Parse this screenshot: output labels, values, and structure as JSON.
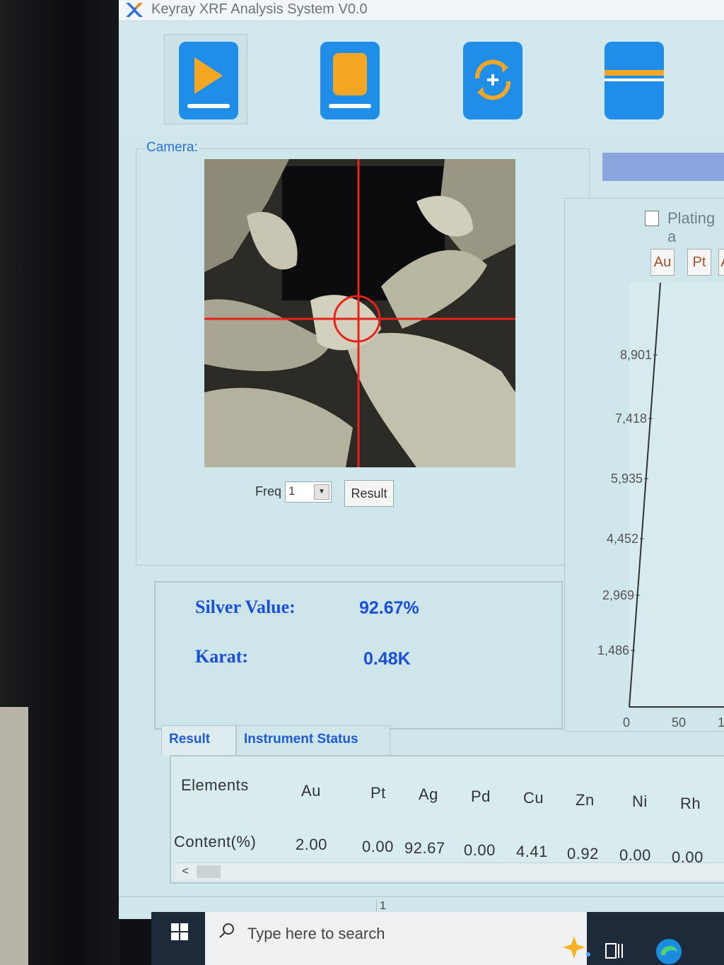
{
  "window": {
    "title": "Keyray XRF Analysis System V0.0"
  },
  "toolbar": {
    "buttons": [
      {
        "icon": "play-icon",
        "color": "#f5a623"
      },
      {
        "icon": "stop-icon",
        "color": "#f5a623"
      },
      {
        "icon": "refresh-icon",
        "color": "#f5a623"
      },
      {
        "icon": "folder-icon",
        "color": "#f5a623"
      }
    ]
  },
  "camera": {
    "label": "Camera:",
    "freq_label": "Freq",
    "freq_value": "1",
    "result_button": "Result"
  },
  "measurement": {
    "silver_label": "Silver Value:",
    "silver_value": "92.67%",
    "karat_label": "Karat:",
    "karat_value": "0.48K"
  },
  "spectrum": {
    "plating_label": "Plating a",
    "element_buttons": [
      "Au",
      "Pt",
      "A"
    ]
  },
  "chart_data": {
    "type": "line",
    "title": "",
    "xlabel": "",
    "ylabel": "",
    "y_ticks": [
      "8,901",
      "7,418",
      "5,935",
      "4,452",
      "2,969",
      "1,486"
    ],
    "x_ticks": [
      "0",
      "50",
      "1"
    ],
    "series": []
  },
  "tabs": [
    {
      "label": "Result"
    },
    {
      "label": "Instrument Status"
    }
  ],
  "results_table": {
    "header_label": "Elements",
    "row_label": "Content(%)",
    "elements": [
      "Au",
      "Pt",
      "Ag",
      "Pd",
      "Cu",
      "Zn",
      "Ni",
      "Rh"
    ],
    "values": [
      "2.00",
      "0.00",
      "92.67",
      "0.00",
      "4.41",
      "0.92",
      "0.00",
      "0.00"
    ]
  },
  "statusbar": {
    "cell": "1"
  },
  "taskbar": {
    "search_placeholder": "Type here to search"
  },
  "colors": {
    "accent_blue": "#1a4fd8",
    "background": "#cfe6ea",
    "crosshair": "#e8231a"
  }
}
